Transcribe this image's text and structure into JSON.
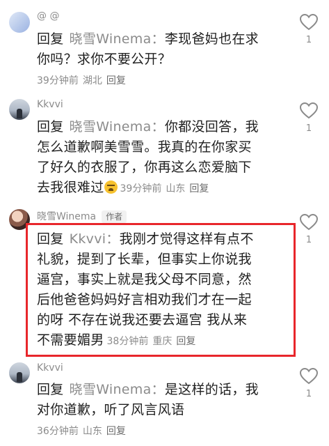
{
  "comments": [
    {
      "username": "@ @",
      "reply_word": "回复",
      "reply_target": "晓雪Winema：",
      "text": "李现爸妈也在求你吗？求你不要公开？",
      "line1": "李现爸妈也在求",
      "line2": "你吗？求你不要公开？",
      "time": "39分钟前",
      "location": "湖北",
      "reply_label": "回复",
      "likes": "1"
    },
    {
      "username": "Kkvvi",
      "reply_word": "回复",
      "reply_target": "晓雪Winema：",
      "line1": "你都没回答，我",
      "line2": "怎么道歉啊美雪雪。我真的在你家买",
      "line3": "了好久的衣服了，你再这么恋爱脑下",
      "line4": "去我很难过",
      "emoji": "crying-face-emoji",
      "time": "39分钟前",
      "location": "山东",
      "reply_label": "回复",
      "likes": "1"
    },
    {
      "username": "晓雪Winema",
      "author_tag": "作者",
      "reply_word": "回复",
      "reply_target": "Kkvvi：",
      "line1": "我刚才觉得这样有点不",
      "line2": "礼貌，提到了长辈，但事实上你说我",
      "line3": "逼宫，事实上就是我父母不同意，然",
      "line4": "后他爸爸妈妈好言相劝我们才在一起",
      "line5": "的呀 不存在说我还要去逼宫 我从来",
      "line6": "不需要媚男",
      "time": "38分钟前",
      "location": "重庆",
      "reply_label": "回复",
      "likes": "1"
    },
    {
      "username": "Kkvvi",
      "reply_word": "回复",
      "reply_target": "晓雪Winema：",
      "line1": "是这样的话，我",
      "line2": "对你道歉，听了风言风语",
      "time": "36分钟前",
      "location": "山东",
      "reply_label": "回复",
      "likes": "1"
    }
  ],
  "colors": {
    "highlight_border": "#e8262b",
    "secondary_text": "#8b8b8b",
    "primary_text": "#1f1f1f"
  }
}
